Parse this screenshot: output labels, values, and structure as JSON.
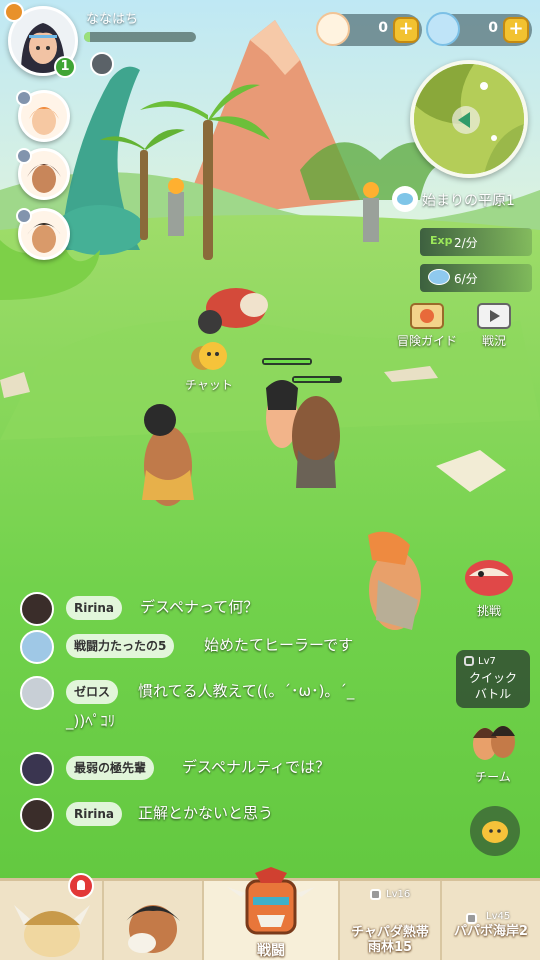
{
  "player": {
    "name": "ななはち",
    "level": "1",
    "exp_fraction": 0.05
  },
  "currencies": [
    {
      "icon": "shell-coin-icon",
      "value": "0"
    },
    {
      "icon": "blue-gem-icon",
      "value": "0"
    }
  ],
  "area": {
    "name": "始まりの平原1",
    "exp_rate": "2/分",
    "exp_tag": "Exp",
    "gem_rate": "6/分"
  },
  "side_buttons": {
    "guide": "冒険ガイド",
    "status": "戦況",
    "chat": "チャット"
  },
  "chat": [
    {
      "name": "Ririna",
      "message": "デスペナって何？"
    },
    {
      "name": "戦闘力たったの5",
      "message": "始めたてヒーラーです"
    },
    {
      "name": "ゼロス",
      "message": "慣れてる人教えて((。´･ω･)。´_",
      "message2": "_))ﾍﾟｺﾘ"
    },
    {
      "name": "最弱の極先輩",
      "message": "デスペナルティでは？"
    },
    {
      "name": "Ririna",
      "message": "正解とかないと思う"
    }
  ],
  "actions": {
    "challenge": "挑戦",
    "quick_battle_lv": "Lv7",
    "quick_battle_line1": "クイック",
    "quick_battle_line2": "バトル",
    "team": "チーム"
  },
  "bottom_nav": {
    "battle": "戦闘",
    "stage1_lv": "Lv16",
    "stage1_line1": "チャパダ熱帯",
    "stage1_line2": "雨林15",
    "stage2_lv": "Lv45",
    "stage2_line1": "パパボ海岸2"
  },
  "colors": {
    "grass": "#6fd44a",
    "level_badge": "#3fa535",
    "plus_button": "#f2c230",
    "nav_bg": "#efe2c6"
  }
}
